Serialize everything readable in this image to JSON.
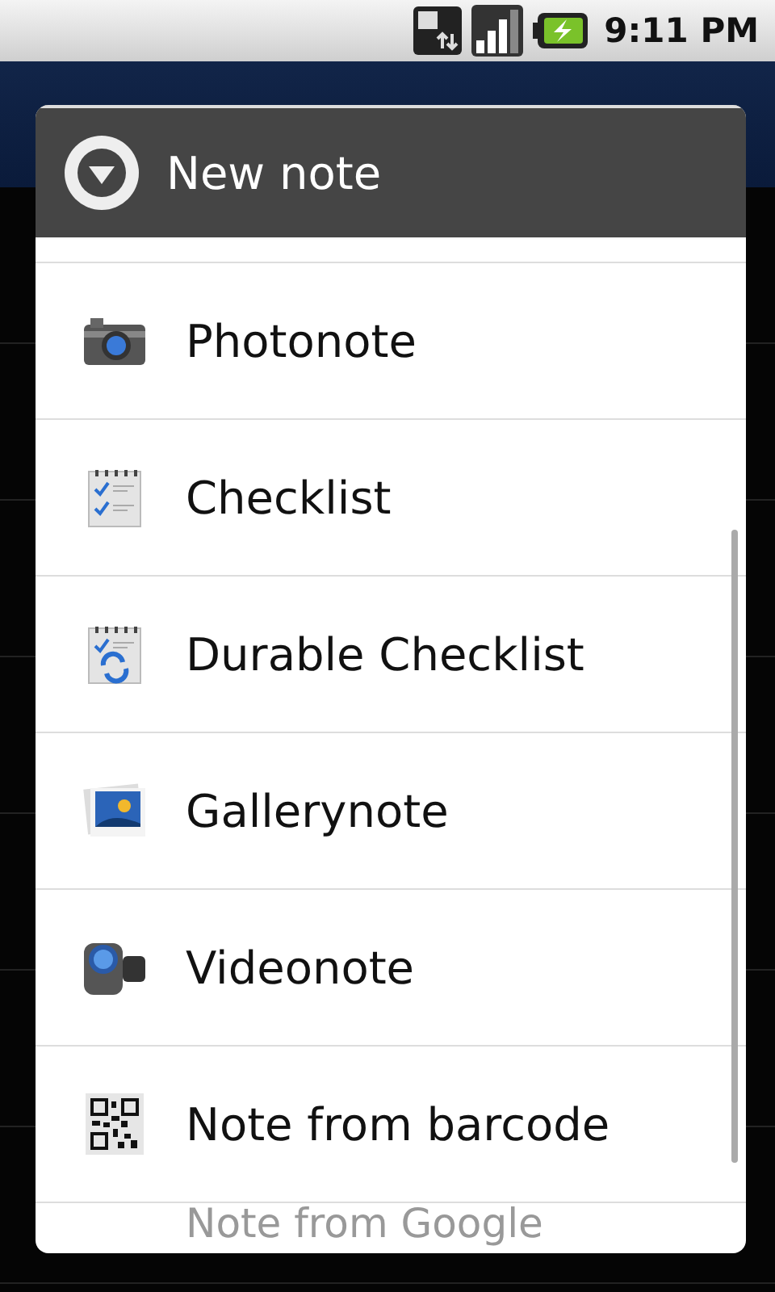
{
  "status_bar": {
    "time": "9:11 PM"
  },
  "dialog": {
    "title": "New note",
    "items": [
      {
        "label": "Photonote"
      },
      {
        "label": "Checklist"
      },
      {
        "label": "Durable Checklist"
      },
      {
        "label": "Gallerynote"
      },
      {
        "label": "Videonote"
      },
      {
        "label": "Note from barcode"
      },
      {
        "label": "Note from Google"
      }
    ]
  }
}
